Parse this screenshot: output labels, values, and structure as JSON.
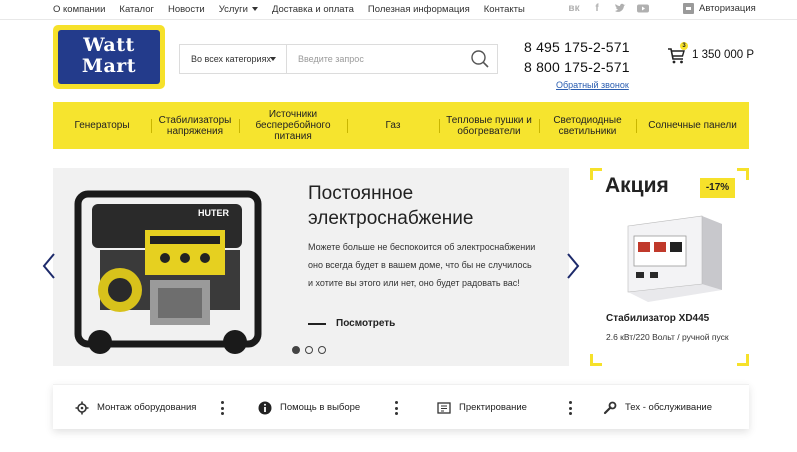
{
  "topnav": {
    "items": [
      "О компании",
      "Каталог",
      "Новости",
      "Услуги",
      "Доставка и оплата",
      "Полезная информация",
      "Контакты"
    ],
    "social_icons": [
      "vk-icon",
      "facebook-icon",
      "twitter-icon",
      "youtube-icon"
    ],
    "auth_label": "Авторизация"
  },
  "header": {
    "logo_line1": "Watt",
    "logo_line2": "Mart",
    "category_select": "Во всех категориях",
    "search_placeholder": "Введите запрос",
    "phone1": "8 495 175-2-571",
    "phone2": "8 800 175-2-571",
    "callback": "Обратный звонок",
    "cart_count": "3",
    "cart_total": "1 350 000 Р"
  },
  "catnav": {
    "items": [
      "Генераторы",
      "Стабилизаторы напряжения",
      "Источники бесперебойного питания",
      "Газ",
      "Тепловые пушки и обогреватели",
      "Светодиодные светильники",
      "Солнечные панели"
    ]
  },
  "slider": {
    "title": "Постоянное электроснабжение",
    "text": "Можете больше не беспокоится об электроснабжении оно всегда будет в вашем доме, что бы не случилось и хотите вы этого или нет, оно будет радовать вас!",
    "more_label": "Посмотреть",
    "brand_label": "HUTER"
  },
  "promo": {
    "title": "Акция",
    "badge": "-17%",
    "name": "Стабилизатор XD445",
    "desc": "2.6 кВт/220 Вольт / ручной пуск"
  },
  "services": {
    "items": [
      "Монтаж оборудования",
      "Помощь в выборе",
      "Пректирование",
      "Тех - обслуживание"
    ]
  },
  "colors": {
    "accent": "#f6e12a",
    "brand_blue": "#233b8b",
    "link": "#2a5db0"
  }
}
